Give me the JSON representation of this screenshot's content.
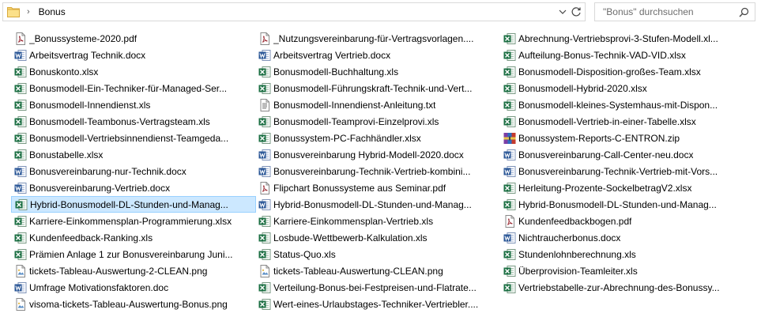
{
  "address": {
    "separator": "›",
    "crumb": "Bonus"
  },
  "search": {
    "placeholder": "\"Bonus\" durchsuchen"
  },
  "colors": {
    "excel": "#1d7044",
    "word": "#2b5797",
    "pdf": "#9b2a33",
    "selection": "#cce8ff"
  },
  "columns": [
    [
      {
        "name": "_Bonussysteme-2020.pdf",
        "icon": "pdf-icon"
      },
      {
        "name": "Arbeitsvertrag Technik.docx",
        "icon": "word-icon"
      },
      {
        "name": "Bonuskonto.xlsx",
        "icon": "excel-icon"
      },
      {
        "name": "Bonusmodell-Ein-Techniker-für-Managed-Ser...",
        "icon": "excel-icon"
      },
      {
        "name": "Bonusmodell-Innendienst.xls",
        "icon": "excel-icon"
      },
      {
        "name": "Bonusmodell-Teambonus-Vertragsteam.xls",
        "icon": "excel-icon"
      },
      {
        "name": "Bonusmodell-Vertriebsinnendienst-Teamgeda...",
        "icon": "excel-icon"
      },
      {
        "name": "Bonustabelle.xlsx",
        "icon": "excel-icon"
      },
      {
        "name": "Bonusvereinbarung-nur-Technik.docx",
        "icon": "word-icon"
      },
      {
        "name": "Bonusvereinbarung-Vertrieb.docx",
        "icon": "word-icon"
      },
      {
        "name": "Hybrid-Bonusmodell-DL-Stunden-und-Manag...",
        "icon": "excel-icon",
        "selected": true
      },
      {
        "name": "Karriere-Einkommensplan-Programmierung.xlsx",
        "icon": "excel-icon"
      },
      {
        "name": "Kundenfeedback-Ranking.xls",
        "icon": "excel-icon"
      },
      {
        "name": "Prämien Anlage 1 zur Bonusvereinbarung Juni...",
        "icon": "excel-icon"
      },
      {
        "name": "tickets-Tableau-Auswertung-2-CLEAN.png",
        "icon": "image-icon"
      },
      {
        "name": "Umfrage Motivationsfaktoren.doc",
        "icon": "word-icon"
      },
      {
        "name": "visoma-tickets-Tableau-Auswertung-Bonus.png",
        "icon": "image-icon"
      }
    ],
    [
      {
        "name": "_Nutzungsvereinbarung-für-Vertragsvorlagen....",
        "icon": "pdf-icon"
      },
      {
        "name": "Arbeitsvertrag Vertrieb.docx",
        "icon": "word-icon"
      },
      {
        "name": "Bonusmodell-Buchhaltung.xls",
        "icon": "excel-icon"
      },
      {
        "name": "Bonusmodell-Führungskraft-Technik-und-Vert...",
        "icon": "excel-icon"
      },
      {
        "name": "Bonusmodell-Innendienst-Anleitung.txt",
        "icon": "text-icon"
      },
      {
        "name": "Bonusmodell-Teamprovi-Einzelprovi.xls",
        "icon": "excel-icon"
      },
      {
        "name": "Bonussystem-PC-Fachhändler.xlsx",
        "icon": "excel-icon"
      },
      {
        "name": "Bonusvereinbarung Hybrid-Modell-2020.docx",
        "icon": "word-icon"
      },
      {
        "name": "Bonusvereinbarung-Technik-Vertrieb-kombini...",
        "icon": "word-icon"
      },
      {
        "name": "Flipchart Bonussysteme aus Seminar.pdf",
        "icon": "pdf-icon"
      },
      {
        "name": "Hybrid-Bonusmodell-DL-Stunden-und-Manag...",
        "icon": "word-icon"
      },
      {
        "name": "Karriere-Einkommensplan-Vertrieb.xls",
        "icon": "excel-icon"
      },
      {
        "name": "Losbude-Wettbewerb-Kalkulation.xls",
        "icon": "excel-icon"
      },
      {
        "name": "Status-Quo.xls",
        "icon": "excel-icon"
      },
      {
        "name": "tickets-Tableau-Auswertung-CLEAN.png",
        "icon": "image-icon"
      },
      {
        "name": "Verteilung-Bonus-bei-Festpreisen-und-Flatrate...",
        "icon": "excel-icon"
      },
      {
        "name": "Wert-eines-Urlaubstages-Techniker-Vertriebler....",
        "icon": "excel-icon"
      }
    ],
    [
      {
        "name": "Abrechnung-Vertriebsprovi-3-Stufen-Modell.xl...",
        "icon": "excel-icon"
      },
      {
        "name": "Aufteilung-Bonus-Technik-VAD-VID.xlsx",
        "icon": "excel-icon"
      },
      {
        "name": "Bonusmodell-Disposition-großes-Team.xlsx",
        "icon": "excel-icon"
      },
      {
        "name": "Bonusmodell-Hybrid-2020.xlsx",
        "icon": "excel-icon"
      },
      {
        "name": "Bonusmodell-kleines-Systemhaus-mit-Dispon...",
        "icon": "excel-icon"
      },
      {
        "name": "Bonusmodell-Vertrieb-in-einer-Tabelle.xlsx",
        "icon": "excel-icon"
      },
      {
        "name": "Bonussystem-Reports-C-ENTRON.zip",
        "icon": "zip-icon"
      },
      {
        "name": "Bonusvereinbarung-Call-Center-neu.docx",
        "icon": "word-icon"
      },
      {
        "name": "Bonusvereinbarung-Technik-Vertrieb-mit-Vors...",
        "icon": "word-icon"
      },
      {
        "name": "Herleitung-Prozente-SockelbetragV2.xlsx",
        "icon": "excel-icon"
      },
      {
        "name": "Hybrid-Bonusmodell-DL-Stunden-und-Manag...",
        "icon": "excel-icon"
      },
      {
        "name": "Kundenfeedbackbogen.pdf",
        "icon": "pdf-icon"
      },
      {
        "name": "Nichtraucherbonus.docx",
        "icon": "word-icon"
      },
      {
        "name": "Stundenlohnberechnung.xls",
        "icon": "excel-icon"
      },
      {
        "name": "Überprovision-Teamleiter.xls",
        "icon": "excel-icon"
      },
      {
        "name": "Vertriebstabelle-zur-Abrechnung-des-Bonussy...",
        "icon": "excel-icon"
      }
    ]
  ]
}
